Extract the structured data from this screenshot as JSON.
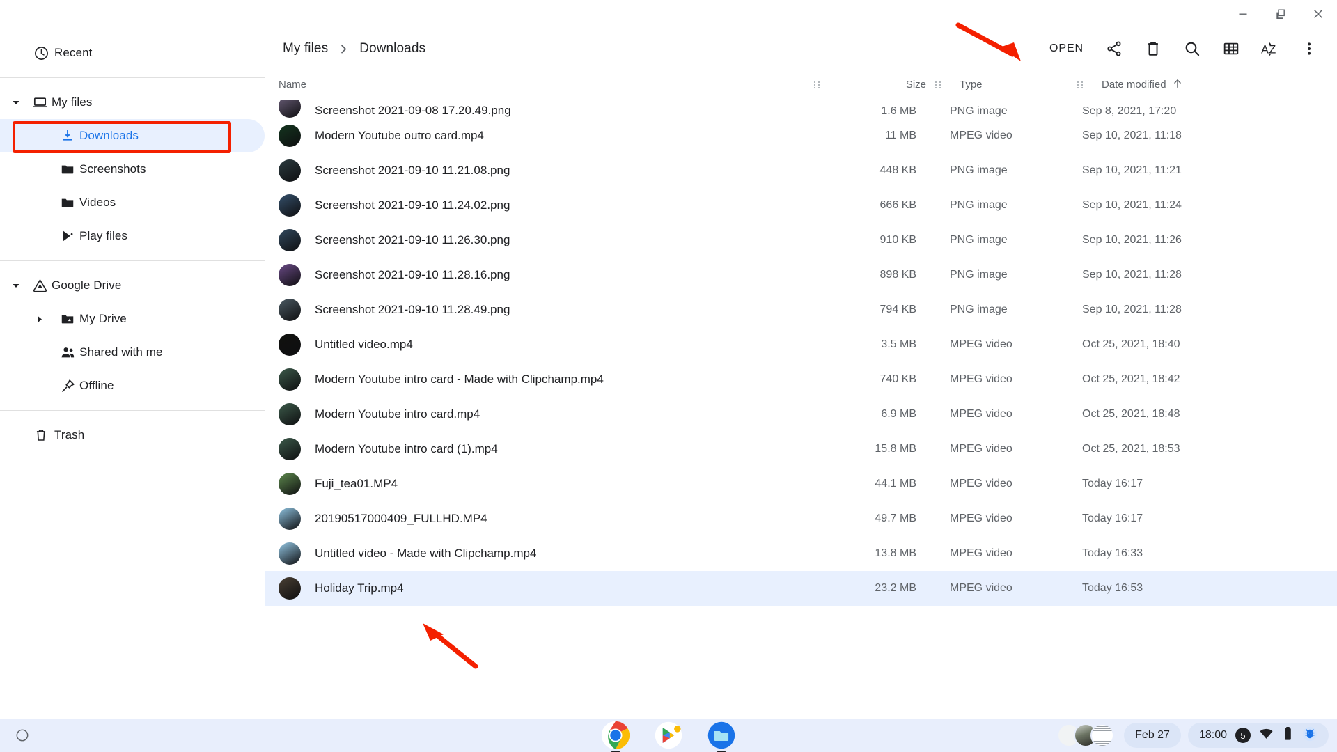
{
  "window": {
    "controls": [
      {
        "name": "minimize-button",
        "glyph": "minimize"
      },
      {
        "name": "restore-button",
        "glyph": "restore"
      },
      {
        "name": "close-button",
        "glyph": "close"
      }
    ]
  },
  "sidebar": {
    "recent": {
      "label": "Recent",
      "icon": "clock-icon"
    },
    "groups": [
      {
        "root": {
          "label": "My files",
          "icon": "laptop-icon",
          "expanded": true
        },
        "children": [
          {
            "label": "Downloads",
            "icon": "download-icon",
            "selected": true
          },
          {
            "label": "Screenshots",
            "icon": "folder-icon",
            "selected": false
          },
          {
            "label": "Videos",
            "icon": "folder-icon",
            "selected": false
          },
          {
            "label": "Play files",
            "icon": "play-store-icon",
            "selected": false
          }
        ]
      },
      {
        "root": {
          "label": "Google Drive",
          "icon": "drive-icon",
          "expanded": true
        },
        "children": [
          {
            "label": "My Drive",
            "icon": "drive-folder-icon",
            "selected": false,
            "hasTwisty": true
          },
          {
            "label": "Shared with me",
            "icon": "people-icon",
            "selected": false
          },
          {
            "label": "Offline",
            "icon": "pin-icon",
            "selected": false
          }
        ]
      }
    ],
    "trash": {
      "label": "Trash",
      "icon": "trash-icon"
    }
  },
  "toolbar": {
    "breadcrumb": [
      "My files",
      "Downloads"
    ],
    "breadcrumb_separator": "chevron-right-icon",
    "open_label": "OPEN",
    "actions": [
      {
        "name": "share-icon",
        "title": "Share"
      },
      {
        "name": "delete-icon",
        "title": "Delete"
      },
      {
        "name": "search-icon",
        "title": "Search"
      },
      {
        "name": "grid-view-icon",
        "title": "Switch to grid view"
      },
      {
        "name": "sort-az-icon",
        "title": "Sort"
      },
      {
        "name": "more-vert-icon",
        "title": "More options"
      }
    ]
  },
  "columns": {
    "name": "Name",
    "size": "Size",
    "type": "Type",
    "date": "Date modified",
    "sort_direction_icon": "arrow-up-icon"
  },
  "files": [
    {
      "name": "Screenshot 2021-09-08 17.20.49.png",
      "size": "1.6 MB",
      "type": "PNG image",
      "date": "Sep 8, 2021, 17:20",
      "thumb": "#6b5f7a",
      "selected": false,
      "clipped": true
    },
    {
      "name": "Modern Youtube outro card.mp4",
      "size": "11 MB",
      "type": "MPEG video",
      "date": "Sep 10, 2021, 11:18",
      "thumb": "#14351f",
      "selected": false,
      "clipped": false
    },
    {
      "name": "Screenshot 2021-09-10 11.21.08.png",
      "size": "448 KB",
      "type": "PNG image",
      "date": "Sep 10, 2021, 11:21",
      "thumb": "#2b3b3f",
      "selected": false,
      "clipped": false
    },
    {
      "name": "Screenshot 2021-09-10 11.24.02.png",
      "size": "666 KB",
      "type": "PNG image",
      "date": "Sep 10, 2021, 11:24",
      "thumb": "#35506b",
      "selected": false,
      "clipped": false
    },
    {
      "name": "Screenshot 2021-09-10 11.26.30.png",
      "size": "910 KB",
      "type": "PNG image",
      "date": "Sep 10, 2021, 11:26",
      "thumb": "#31495e",
      "selected": false,
      "clipped": false
    },
    {
      "name": "Screenshot 2021-09-10 11.28.16.png",
      "size": "898 KB",
      "type": "PNG image",
      "date": "Sep 10, 2021, 11:28",
      "thumb": "#6a4a86",
      "selected": false,
      "clipped": false
    },
    {
      "name": "Screenshot 2021-09-10 11.28.49.png",
      "size": "794 KB",
      "type": "PNG image",
      "date": "Sep 10, 2021, 11:28",
      "thumb": "#4b5a63",
      "selected": false,
      "clipped": false
    },
    {
      "name": "Untitled video.mp4",
      "size": "3.5 MB",
      "type": "MPEG video",
      "date": "Oct 25, 2021, 18:40",
      "thumb": "#11120f",
      "selected": false,
      "clipped": false
    },
    {
      "name": "Modern Youtube intro card - Made with Clipchamp.mp4",
      "size": "740 KB",
      "type": "MPEG video",
      "date": "Oct 25, 2021, 18:42",
      "thumb": "#3c5a4a",
      "selected": false,
      "clipped": false
    },
    {
      "name": "Modern Youtube intro card.mp4",
      "size": "6.9 MB",
      "type": "MPEG video",
      "date": "Oct 25, 2021, 18:48",
      "thumb": "#3c5a4a",
      "selected": false,
      "clipped": false
    },
    {
      "name": "Modern Youtube intro card (1).mp4",
      "size": "15.8 MB",
      "type": "MPEG video",
      "date": "Oct 25, 2021, 18:53",
      "thumb": "#3c5a4a",
      "selected": false,
      "clipped": false
    },
    {
      "name": "Fuji_tea01.MP4",
      "size": "44.1 MB",
      "type": "MPEG video",
      "date": "Today 16:17",
      "thumb": "#5e8a4e",
      "selected": false,
      "clipped": false
    },
    {
      "name": "20190517000409_FULLHD.MP4",
      "size": "49.7 MB",
      "type": "MPEG video",
      "date": "Today 16:17",
      "thumb": "#8fc3e0",
      "selected": false,
      "clipped": false
    },
    {
      "name": "Untitled video - Made with Clipchamp.mp4",
      "size": "13.8 MB",
      "type": "MPEG video",
      "date": "Today 16:33",
      "thumb": "#93c6e3",
      "selected": false,
      "clipped": false
    },
    {
      "name": "Holiday Trip.mp4",
      "size": "23.2 MB",
      "type": "MPEG video",
      "date": "Today 16:53",
      "thumb": "#4a4034",
      "selected": true,
      "clipped": false
    }
  ],
  "annotations": {
    "open_arrow": {
      "color": "#f42000",
      "points_to": "OPEN"
    },
    "file_arrow": {
      "color": "#f42000",
      "points_to": "Holiday Trip.mp4"
    },
    "downloads_box": {
      "color": "#f42000",
      "points_to": "Downloads"
    }
  },
  "shelf": {
    "launcher": {
      "name": "launcher-button"
    },
    "apps": [
      {
        "name": "chrome-icon",
        "label": "Chrome",
        "running": true
      },
      {
        "name": "play-store-icon",
        "label": "Play Store",
        "running": false
      },
      {
        "name": "files-icon",
        "label": "Files",
        "running": true
      }
    ],
    "tray": {
      "date": "Feb 27",
      "time": "18:00",
      "notification_count": "5",
      "icons": [
        "wifi-icon",
        "battery-icon",
        "android-bug-icon"
      ]
    }
  },
  "colors": {
    "accent": "#1a73e8",
    "selection_bg": "#e8f0fe",
    "annotation_red": "#f42000",
    "shelf_bg": "#e8eefc",
    "text_primary": "#202124",
    "text_secondary": "#5f6368"
  }
}
